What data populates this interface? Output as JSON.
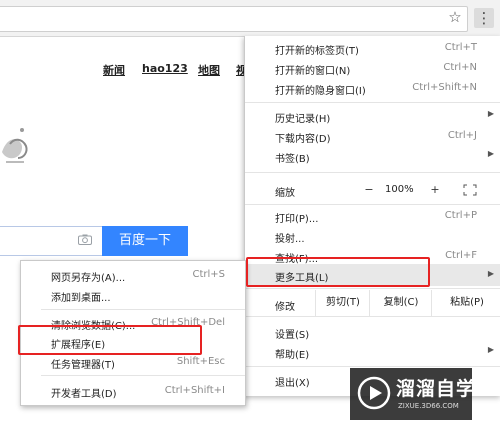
{
  "page": {
    "links": [
      "新闻",
      "hao123",
      "地图",
      "视"
    ],
    "search_button": "百度一下"
  },
  "menu": {
    "items": [
      {
        "label": "打开新的标签页(T)",
        "shortcut": "Ctrl+T"
      },
      {
        "label": "打开新的窗口(N)",
        "shortcut": "Ctrl+N"
      },
      {
        "label": "打开新的隐身窗口(I)",
        "shortcut": "Ctrl+Shift+N"
      },
      {
        "label": "历史记录(H)",
        "shortcut": ""
      },
      {
        "label": "下载内容(D)",
        "shortcut": "Ctrl+J"
      },
      {
        "label": "书签(B)",
        "shortcut": ""
      },
      {
        "label": "打印(P)...",
        "shortcut": "Ctrl+P"
      },
      {
        "label": "投射...",
        "shortcut": ""
      },
      {
        "label": "查找(F)...",
        "shortcut": "Ctrl+F"
      },
      {
        "label": "更多工具(L)",
        "shortcut": ""
      },
      {
        "label": "设置(S)",
        "shortcut": ""
      },
      {
        "label": "帮助(E)",
        "shortcut": ""
      },
      {
        "label": "退出(X)",
        "shortcut": ""
      }
    ],
    "zoom": {
      "label": "缩放",
      "minus": "−",
      "value": "100%",
      "plus": "+"
    },
    "edit": {
      "label": "修改",
      "cut": "剪切(T)",
      "copy": "复制(C)",
      "paste": "粘贴(P)"
    }
  },
  "submenu": {
    "items": [
      {
        "label": "网页另存为(A)...",
        "shortcut": "Ctrl+S"
      },
      {
        "label": "添加到桌面...",
        "shortcut": ""
      },
      {
        "label": "清除浏览数据(C)...",
        "shortcut": "Ctrl+Shift+Del"
      },
      {
        "label": "扩展程序(E)",
        "shortcut": ""
      },
      {
        "label": "任务管理器(T)",
        "shortcut": "Shift+Esc"
      },
      {
        "label": "开发者工具(D)",
        "shortcut": "Ctrl+Shift+I"
      }
    ]
  },
  "watermark": {
    "title": "溜溜自学",
    "url": "ZIXUE.3D66.COM"
  },
  "colors": {
    "highlight_border": "#e62222",
    "search_button_bg": "#3385ff"
  },
  "icons": {
    "star": "bookmark-star-icon",
    "menu": "vertical-ellipsis-icon",
    "camera": "camera-icon",
    "fullscreen": "fullscreen-icon"
  }
}
